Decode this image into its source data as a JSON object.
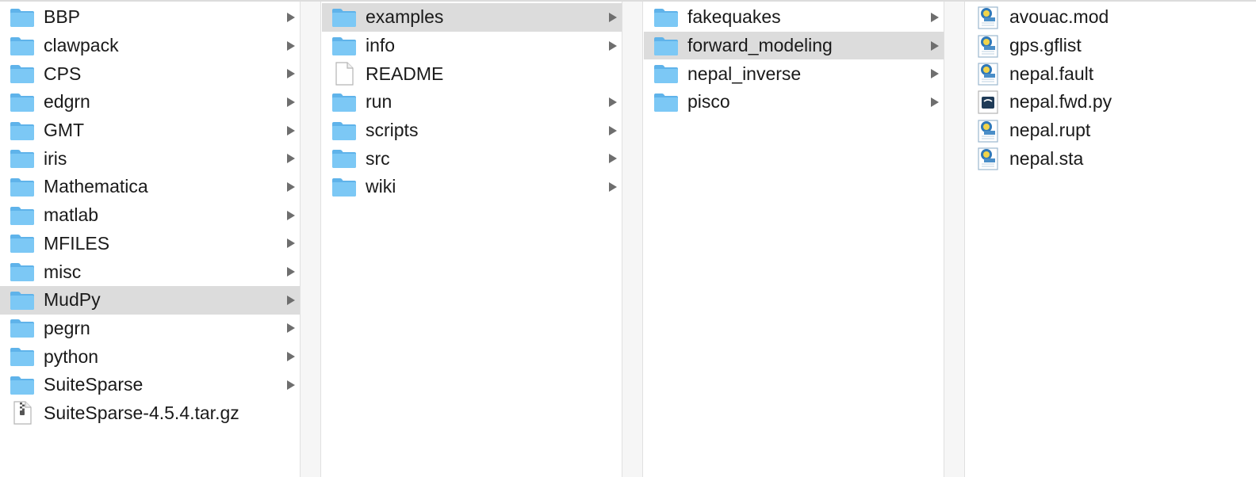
{
  "columns": [
    {
      "items": [
        {
          "name": "BBP",
          "kind": "folder",
          "has_children": true,
          "selected": false
        },
        {
          "name": "clawpack",
          "kind": "folder",
          "has_children": true,
          "selected": false
        },
        {
          "name": "CPS",
          "kind": "folder",
          "has_children": true,
          "selected": false
        },
        {
          "name": "edgrn",
          "kind": "folder",
          "has_children": true,
          "selected": false
        },
        {
          "name": "GMT",
          "kind": "folder",
          "has_children": true,
          "selected": false
        },
        {
          "name": "iris",
          "kind": "folder",
          "has_children": true,
          "selected": false
        },
        {
          "name": "Mathematica",
          "kind": "folder",
          "has_children": true,
          "selected": false
        },
        {
          "name": "matlab",
          "kind": "folder",
          "has_children": true,
          "selected": false
        },
        {
          "name": "MFILES",
          "kind": "folder",
          "has_children": true,
          "selected": false
        },
        {
          "name": "misc",
          "kind": "folder",
          "has_children": true,
          "selected": false
        },
        {
          "name": "MudPy",
          "kind": "folder",
          "has_children": true,
          "selected": true
        },
        {
          "name": "pegrn",
          "kind": "folder",
          "has_children": true,
          "selected": false
        },
        {
          "name": "python",
          "kind": "folder",
          "has_children": true,
          "selected": false
        },
        {
          "name": "SuiteSparse",
          "kind": "folder",
          "has_children": true,
          "selected": false
        },
        {
          "name": "SuiteSparse-4.5.4.tar.gz",
          "kind": "archive",
          "has_children": false,
          "selected": false
        }
      ]
    },
    {
      "items": [
        {
          "name": "examples",
          "kind": "folder",
          "has_children": true,
          "selected": true
        },
        {
          "name": "info",
          "kind": "folder",
          "has_children": true,
          "selected": false
        },
        {
          "name": "README",
          "kind": "document",
          "has_children": false,
          "selected": false
        },
        {
          "name": "run",
          "kind": "folder",
          "has_children": true,
          "selected": false
        },
        {
          "name": "scripts",
          "kind": "folder",
          "has_children": true,
          "selected": false
        },
        {
          "name": "src",
          "kind": "folder",
          "has_children": true,
          "selected": false
        },
        {
          "name": "wiki",
          "kind": "folder",
          "has_children": true,
          "selected": false
        }
      ]
    },
    {
      "items": [
        {
          "name": "fakequakes",
          "kind": "folder",
          "has_children": true,
          "selected": false
        },
        {
          "name": "forward_modeling",
          "kind": "folder",
          "has_children": true,
          "selected": true
        },
        {
          "name": "nepal_inverse",
          "kind": "folder",
          "has_children": true,
          "selected": false
        },
        {
          "name": "pisco",
          "kind": "folder",
          "has_children": true,
          "selected": false
        }
      ]
    },
    {
      "items": [
        {
          "name": "avouac.mod",
          "kind": "text-file",
          "has_children": false,
          "selected": false
        },
        {
          "name": "gps.gflist",
          "kind": "text-file",
          "has_children": false,
          "selected": false
        },
        {
          "name": "nepal.fault",
          "kind": "text-file",
          "has_children": false,
          "selected": false
        },
        {
          "name": "nepal.fwd.py",
          "kind": "python-file",
          "has_children": false,
          "selected": false
        },
        {
          "name": "nepal.rupt",
          "kind": "text-file",
          "has_children": false,
          "selected": false
        },
        {
          "name": "nepal.sta",
          "kind": "text-file",
          "has_children": false,
          "selected": false
        }
      ]
    }
  ],
  "colors": {
    "folder_body": "#7cc8f5",
    "folder_tab": "#5fb3ea",
    "selection_bg": "#dcdcdc",
    "arrow": "#6e6e6e"
  }
}
